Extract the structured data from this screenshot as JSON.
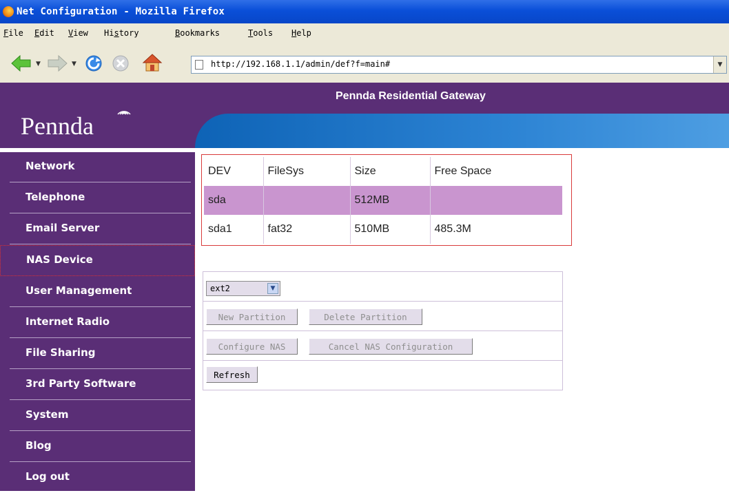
{
  "window": {
    "title": "Net Configuration - Mozilla Firefox"
  },
  "menu": [
    {
      "label": "File",
      "key": "F",
      "rest": "ile"
    },
    {
      "label": "Edit",
      "key": "E",
      "rest": "dit"
    },
    {
      "label": "View",
      "key": "V",
      "rest": "iew"
    },
    {
      "label": "History",
      "pre": "Hi",
      "key": "s",
      "rest": "tory"
    },
    {
      "label": "Bookmarks",
      "key": "B",
      "rest": "ookmarks"
    },
    {
      "label": "Tools",
      "key": "T",
      "rest": "ools"
    },
    {
      "label": "Help",
      "key": "H",
      "rest": "elp"
    }
  ],
  "toolbar": {
    "icons": [
      "back-icon",
      "forward-icon",
      "reload-icon",
      "stop-icon",
      "home-icon"
    ],
    "url": "http://192.168.1.1/admin/def?f=main#"
  },
  "header": {
    "title": "Pennda Residential Gateway",
    "logo": "Pennda"
  },
  "sidebar": {
    "items": [
      {
        "label": "Network",
        "active": false
      },
      {
        "label": "Telephone",
        "active": false
      },
      {
        "label": "Email Server",
        "active": false
      },
      {
        "label": "NAS Device",
        "active": true
      },
      {
        "label": "User Management",
        "active": false
      },
      {
        "label": "Internet Radio",
        "active": false
      },
      {
        "label": "File Sharing",
        "active": false
      },
      {
        "label": "3rd Party Software",
        "active": false
      },
      {
        "label": "System",
        "active": false
      },
      {
        "label": "Blog",
        "active": false
      },
      {
        "label": "Log out",
        "active": false
      }
    ]
  },
  "devices": {
    "headers": [
      "DEV",
      "FileSys",
      "Size",
      "Free Space"
    ],
    "rows": [
      [
        "sda",
        "",
        "512MB",
        ""
      ],
      [
        "sda1",
        "fat32",
        "510MB",
        "485.3M"
      ]
    ]
  },
  "controls": {
    "fs_select": "ext2",
    "new_partition": "New Partition",
    "delete_partition": "Delete Partition",
    "configure_nas": "Configure NAS",
    "cancel_nas": "Cancel NAS Configuration",
    "refresh": "Refresh"
  },
  "colors": {
    "sidebar_bg": "#5a2e76",
    "header_blue": "#2d84d4",
    "highlight_row": "#c995cf",
    "active_border": "#e03030"
  }
}
